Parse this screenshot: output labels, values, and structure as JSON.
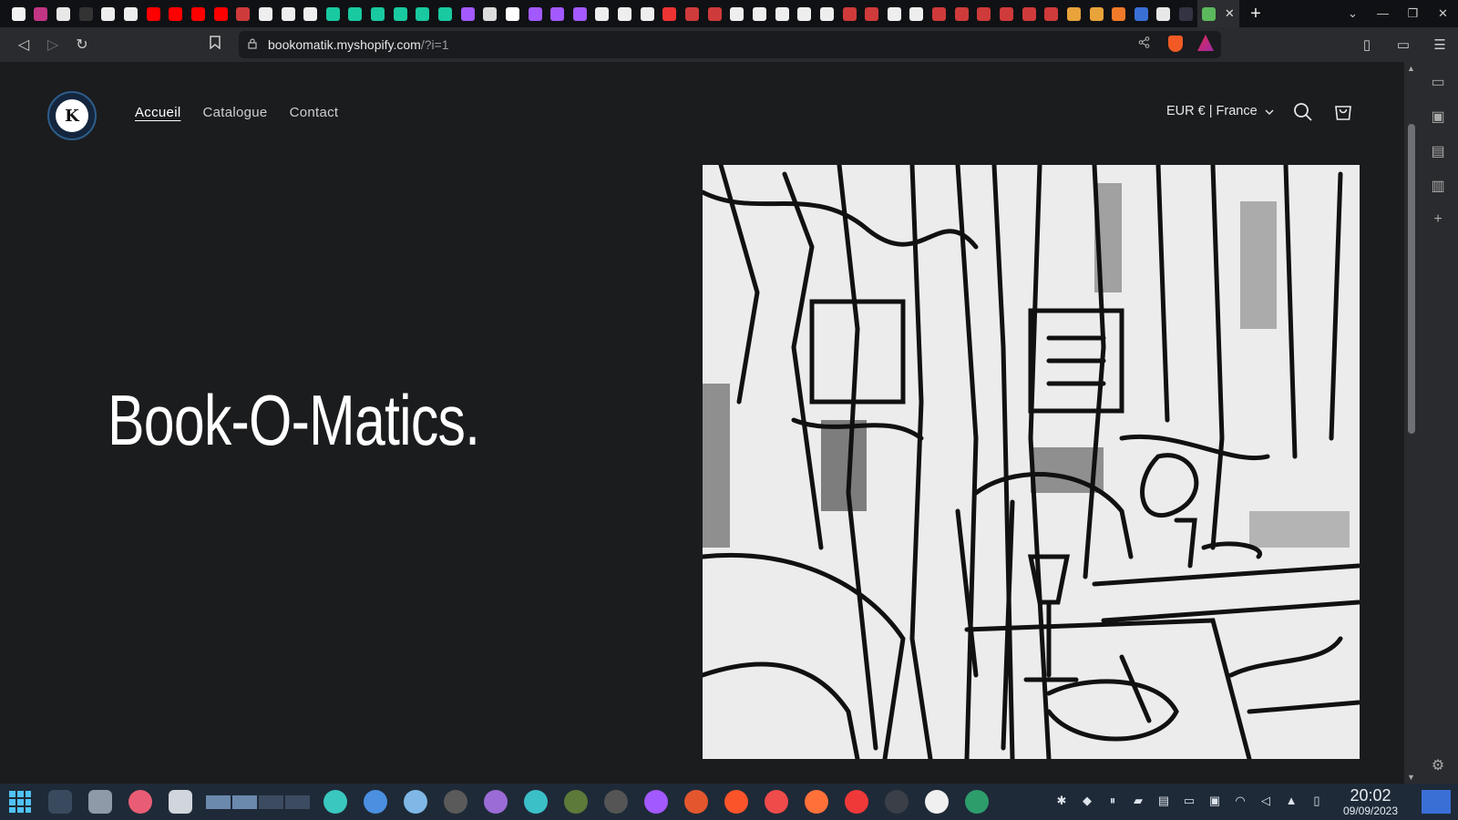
{
  "browser": {
    "tab_favicons": [
      "#f2f2f2",
      "#c13584",
      "#e8e8e8",
      "#333",
      "#eee",
      "#eee",
      "#f00",
      "#f00",
      "#f00",
      "#f00",
      "#cf3a3a",
      "#eee",
      "#eee",
      "#eee",
      "#19c9a0",
      "#19c9a0",
      "#19c9a0",
      "#19c9a0",
      "#19c9a0",
      "#19c9a0",
      "#a259ff",
      "#ddd",
      "#fff",
      "#a259ff",
      "#a259ff",
      "#a259ff",
      "#eee",
      "#eee",
      "#eee",
      "#e33",
      "#cf3a3a",
      "#cf3a3a",
      "#eee",
      "#eee",
      "#eee",
      "#eee",
      "#eee",
      "#cf3a3a",
      "#cf3a3a",
      "#eee",
      "#eee",
      "#cf3a3a",
      "#cf3a3a",
      "#cf3a3a",
      "#cf3a3a",
      "#cf3a3a",
      "#cf3a3a",
      "#e8a33a",
      "#e8a33a",
      "#f07a2a",
      "#3a6fd6",
      "#e8e8e8",
      "#334",
      "#5cb85c"
    ],
    "url_host": "bookomatik.myshopify.com",
    "url_query": "/?i=1",
    "new_tab_symbol": "+",
    "close_tab_symbol": "✕"
  },
  "site": {
    "logo_letter": "K",
    "nav": [
      {
        "label": "Accueil",
        "active": true
      },
      {
        "label": "Catalogue",
        "active": false
      },
      {
        "label": "Contact",
        "active": false
      }
    ],
    "locale": "EUR € | France",
    "hero_title": "Book-O-Matics."
  },
  "taskbar": {
    "time": "20:02",
    "date": "09/09/2023",
    "app_colors": [
      "#39c7c0",
      "#4b8fe0",
      "#7fb8e6",
      "#5a5a5a",
      "#9b6cd6",
      "#3bc0c8",
      "#5d7a3a",
      "#555",
      "#a259ff",
      "#e4572e",
      "#fb542b",
      "#f04b4b",
      "#ff7139",
      "#ef3939",
      "#3a3f48",
      "#f0f0f0",
      "#2d9d6c"
    ]
  },
  "colors": {
    "page_bg": "#1b1c1e",
    "accent_taskbar": "#1f2a38",
    "show_desktop": "#3a6fd6"
  }
}
